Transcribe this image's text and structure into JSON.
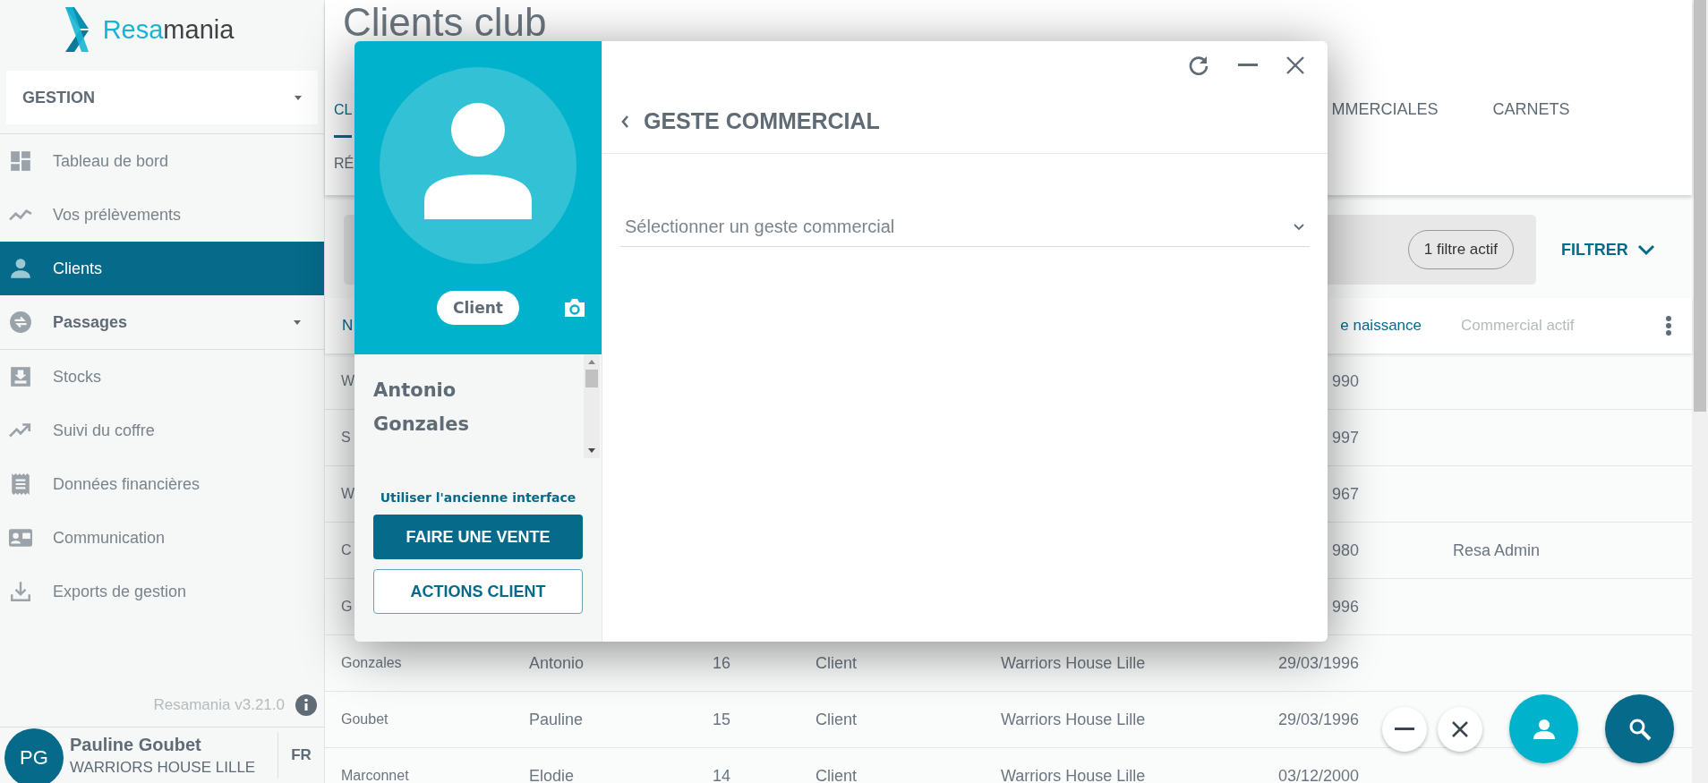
{
  "sidebar": {
    "logo": {
      "part_1": "Resa",
      "part_2": "mania"
    },
    "module_select": {
      "value": "GESTION"
    },
    "items": [
      {
        "label": "Tableau de bord",
        "kind": "link",
        "selected": false
      },
      {
        "label": "Vos prélèvements",
        "kind": "link",
        "selected": false
      },
      {
        "label": "Clients",
        "kind": "link",
        "selected": true
      },
      {
        "label": "Passages",
        "kind": "group",
        "selected": false
      },
      {
        "label": "Stocks",
        "kind": "link",
        "selected": false
      },
      {
        "label": "Suivi du coffre",
        "kind": "link",
        "selected": false
      },
      {
        "label": "Données financières",
        "kind": "link",
        "selected": false
      },
      {
        "label": "Communication",
        "kind": "link",
        "selected": false
      },
      {
        "label": "Exports de gestion",
        "kind": "link",
        "selected": false
      }
    ],
    "version": "Resamania v3.21.0",
    "user": {
      "initials": "PG",
      "name": "Pauline Goubet",
      "club": "WARRIORS HOUSE LILLE"
    },
    "language": "FR"
  },
  "main": {
    "title": "Clients club",
    "tabs": [
      {
        "label": "CL",
        "selected": true
      },
      {
        "label": "MMERCIALES",
        "selected": false
      },
      {
        "label": "CARNETS",
        "selected": false
      }
    ],
    "tabs_row_2": [
      {
        "label": "RÉ",
        "selected": false
      }
    ],
    "filter": {
      "chip": "1 filtre actif",
      "button": "FILTRER"
    },
    "table": {
      "columns": {
        "column_1": "N",
        "column_6": "e naissance",
        "column_7": "Commercial actif"
      },
      "rows": [
        {
          "column_1": "W",
          "column_6": "990"
        },
        {
          "column_1": "S",
          "column_6": "997"
        },
        {
          "column_1": "W",
          "column_6": "967"
        },
        {
          "column_1": "C",
          "column_6": "980",
          "column_7": "Resa Admin"
        },
        {
          "column_1": "G",
          "column_6": "996"
        },
        {
          "column_1": "Gonzales",
          "column_2": "Antonio",
          "column_3": "16",
          "column_4": "Client",
          "column_5": "Warriors House Lille",
          "column_6": "29/03/1996"
        },
        {
          "column_1": "Goubet",
          "column_2": "Pauline",
          "column_3": "15",
          "column_4": "Client",
          "column_5": "Warriors House Lille",
          "column_6": "29/03/1996"
        },
        {
          "column_1": "Marconnet",
          "column_2": "Elodie",
          "column_3": "14",
          "column_4": "Client",
          "column_5": "Warriors House Lille",
          "column_6": "03/12/2000"
        }
      ]
    }
  },
  "modal": {
    "profile": {
      "badge": "Client",
      "first_name": "Antonio",
      "last_name": "Gonzales",
      "old_interface_link": "Utiliser l'ancienne interface",
      "primary_button": "FAIRE UNE VENTE",
      "secondary_button": "ACTIONS CLIENT"
    },
    "panel": {
      "title": "GESTE COMMERCIAL",
      "select": {
        "placeholder": "Sélectionner un geste commercial"
      }
    }
  }
}
